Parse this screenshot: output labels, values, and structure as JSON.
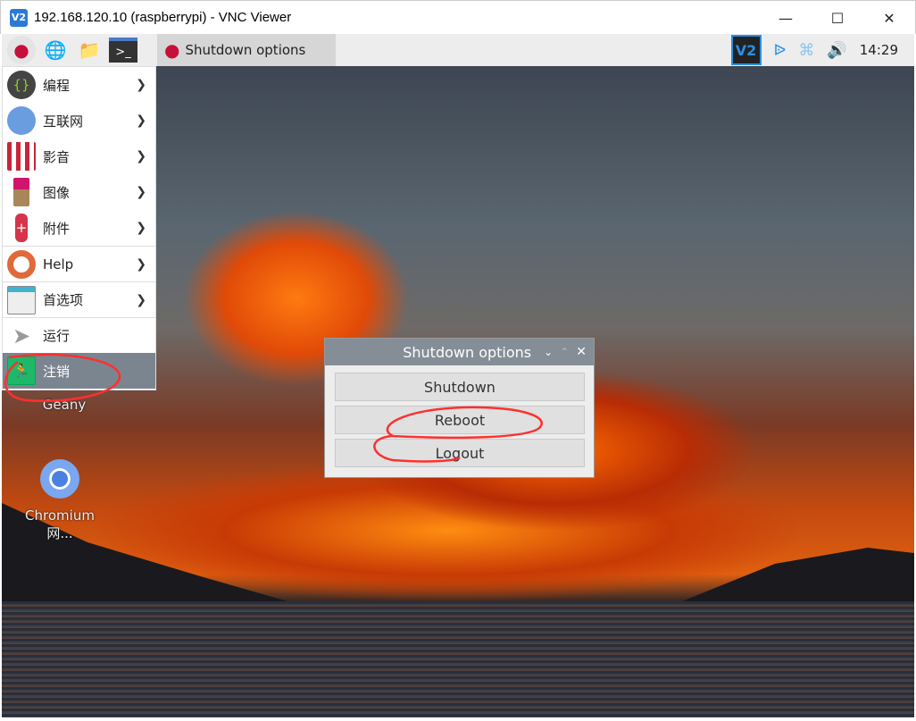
{
  "window": {
    "title": "192.168.120.10 (raspberrypi) - VNC Viewer",
    "logo": "V2",
    "controls": [
      "minimize-icon",
      "maximize-icon",
      "close-icon"
    ]
  },
  "panel": {
    "launchers": [
      "raspberry-menu-icon",
      "globe-icon",
      "folder-icon",
      "terminal-icon"
    ],
    "task_label": "Shutdown options",
    "tray": {
      "vnc": "V2",
      "clock": "14:29"
    }
  },
  "menu": {
    "items": [
      {
        "label": "编程",
        "icon": "code-braces-icon",
        "submenu": true
      },
      {
        "label": "互联网",
        "icon": "globe-icon",
        "submenu": true
      },
      {
        "label": "影音",
        "icon": "popcorn-play-icon",
        "submenu": true
      },
      {
        "label": "图像",
        "icon": "paintbrush-icon",
        "submenu": true
      },
      {
        "label": "附件",
        "icon": "swiss-knife-icon",
        "submenu": true
      },
      {
        "label": "Help",
        "icon": "lifebuoy-icon",
        "submenu": true
      },
      {
        "label": "首选项",
        "icon": "sliders-icon",
        "submenu": true
      },
      {
        "label": "运行",
        "icon": "paper-plane-icon",
        "submenu": false
      },
      {
        "label": "注销",
        "icon": "exit-running-man-icon",
        "submenu": false,
        "selected": true
      }
    ]
  },
  "desktop": {
    "icons": [
      {
        "label": "Geany"
      },
      {
        "label": "Chromium 网..."
      }
    ]
  },
  "dialog": {
    "title": "Shutdown options",
    "buttons": [
      "Shutdown",
      "Reboot",
      "Logout"
    ]
  },
  "colors": {
    "annotation": "#ff3030",
    "accent": "#2a8ee8",
    "selected": "#7b8590"
  }
}
